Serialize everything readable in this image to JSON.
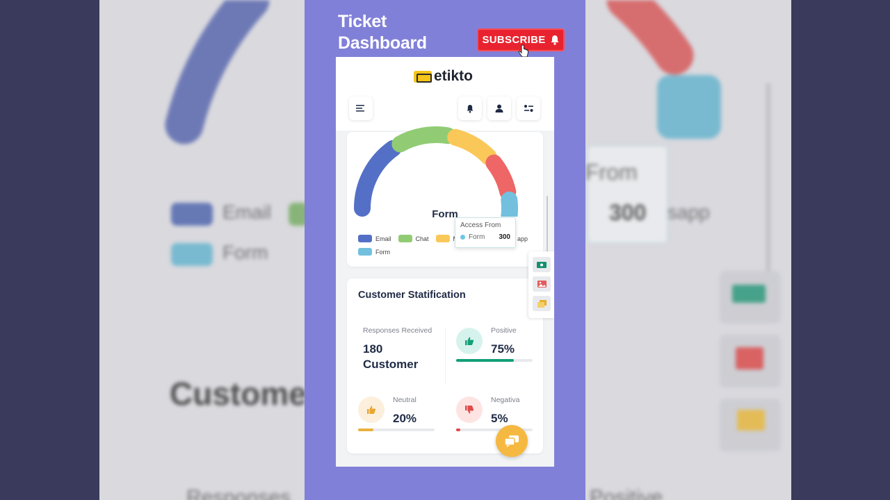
{
  "video": {
    "title": "Ticket Dashboard",
    "subscribe_label": "SUBSCRIBE"
  },
  "app": {
    "logo_text": "etikto"
  },
  "access_chart": {
    "center_label": "Form",
    "legend": [
      {
        "label": "Email",
        "color": "#5470c6"
      },
      {
        "label": "Chat",
        "color": "#91cc75"
      },
      {
        "label": "Me",
        "color": "#fac858"
      },
      {
        "label": "app",
        "color": "#ee6666"
      },
      {
        "label": "Form",
        "color": "#73c0de"
      }
    ],
    "tooltip": {
      "title": "Access From",
      "series": "Form",
      "value": "300"
    }
  },
  "chart_data": {
    "type": "pie",
    "title": "",
    "categories": [
      "Email",
      "Chat",
      "Me",
      "app",
      "Form"
    ],
    "colors": [
      "#5470c6",
      "#91cc75",
      "#fac858",
      "#ee6666",
      "#73c0de"
    ],
    "values": [
      1048,
      735,
      580,
      484,
      300
    ]
  },
  "satisfaction": {
    "title": "Customer Statification",
    "responses_label": "Responses Received",
    "responses_value": "180",
    "responses_unit": "Customer",
    "positive_label": "Positive",
    "positive_value": "75%",
    "positive_level": 0.75,
    "neutral_label": "Neutral",
    "neutral_value": "20%",
    "neutral_level": 0.2,
    "negative_label": "Negativa",
    "negative_value": "5%",
    "negative_level": 0.05
  },
  "background": {
    "legend_email": "Email",
    "legend_form": "Form",
    "from_text": "From",
    "value_text": "300",
    "app_text": "sapp",
    "customer_text": "Custome",
    "responses_text": "Responses",
    "positive_text": "Positive"
  }
}
